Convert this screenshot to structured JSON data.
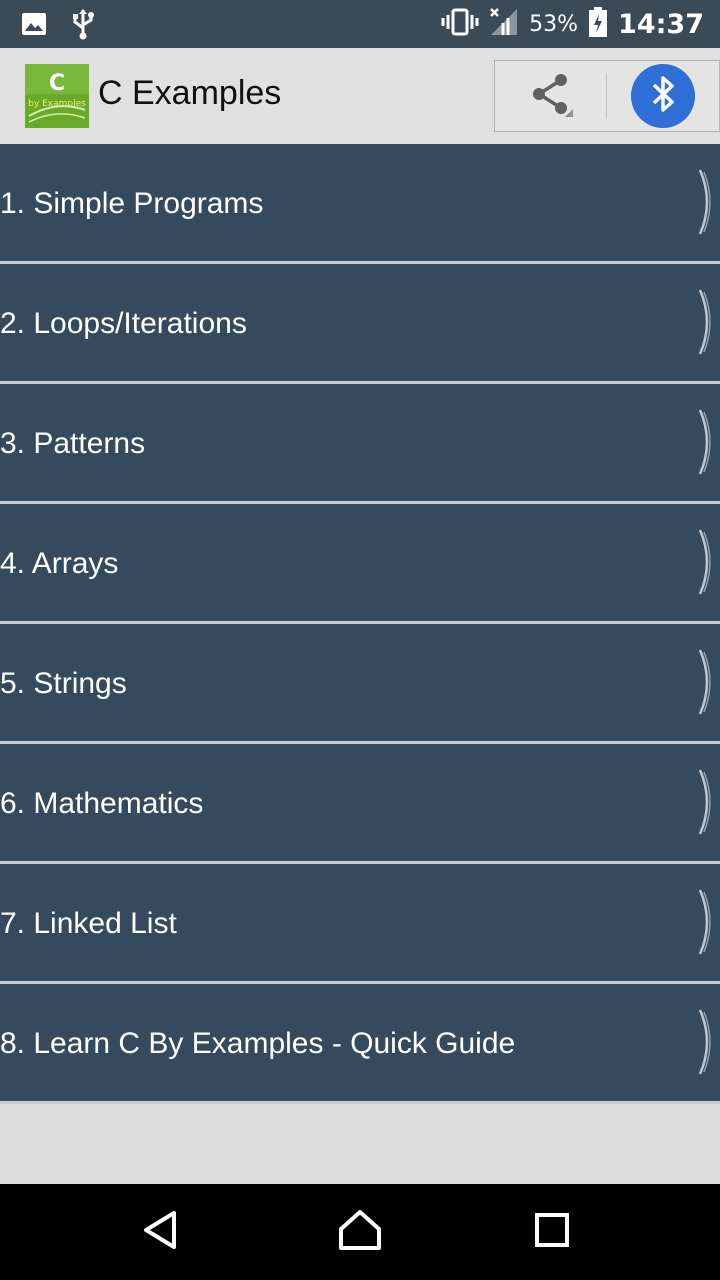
{
  "status_bar": {
    "battery_percent": "53%",
    "time": "14:37",
    "icons": [
      "image-icon",
      "usb-icon",
      "vibrate-icon",
      "signal-icon",
      "battery-icon"
    ]
  },
  "action_bar": {
    "title": "C Examples",
    "logo_text": "C",
    "logo_subtext": "by Examples",
    "share_icon": "share-icon",
    "bluetooth_icon": "bluetooth-icon"
  },
  "menu": {
    "items": [
      {
        "label": "1. Simple Programs"
      },
      {
        "label": "2. Loops/Iterations"
      },
      {
        "label": "3. Patterns"
      },
      {
        "label": "4. Arrays"
      },
      {
        "label": "5. Strings"
      },
      {
        "label": "6. Mathematics"
      },
      {
        "label": "7. Linked List"
      },
      {
        "label": "8. Learn C By Examples - Quick Guide"
      }
    ]
  },
  "nav_bar": {
    "buttons": [
      "back-icon",
      "home-icon",
      "recents-icon"
    ]
  },
  "colors": {
    "status_bar": "#3b4a57",
    "action_bar": "#e0e0e0",
    "menu_item": "#364a5f",
    "bluetooth": "#2f6fd8",
    "nav_bar": "#000000"
  }
}
